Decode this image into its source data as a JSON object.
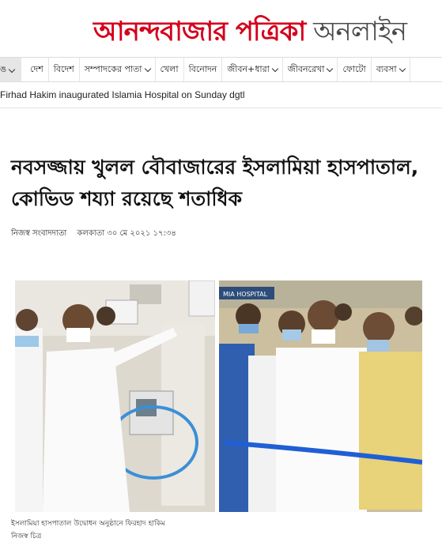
{
  "masthead": {
    "logo_red": "আনন্দবাজার পত্রিকা",
    "logo_grey": " অনলাইন"
  },
  "nav": {
    "first": "ঙ",
    "items": [
      {
        "label": "দেশ",
        "dropdown": false
      },
      {
        "label": "বিদেশ",
        "dropdown": false
      },
      {
        "label": "সম্পাদকের পাতা",
        "dropdown": true
      },
      {
        "label": "খেলা",
        "dropdown": false
      },
      {
        "label": "বিনোদন",
        "dropdown": false
      },
      {
        "label": "জীবন+ধারা",
        "dropdown": true
      },
      {
        "label": "জীবনরেখা",
        "dropdown": true
      },
      {
        "label": "ফোটো",
        "dropdown": false
      },
      {
        "label": "ব্যবসা",
        "dropdown": true
      }
    ]
  },
  "article": {
    "strap": "Firhad Hakim inaugurated Islamia Hospital on Sunday dgtl",
    "headline": "নবসজ্জায় খুলল বৌবাজারের ইসলামিয়া হাসপাতাল, কোভিড শয্যা রয়েছে শতাধিক",
    "author": "নিজস্ব সংবাদদাতা",
    "dateline": "কলকাতা ৩০ মে ২০২১ ১৭:৩৪",
    "photo_sign": "MIA HOSPITAL",
    "caption": "ইসলামিয়া হাসপাতাল উদ্বোধন অনুষ্ঠানে ফিরহাদ হাকিম",
    "credit": "নিজস্ব চিত্র"
  },
  "colors": {
    "brand_red": "#d4001c",
    "logo_grey": "#4a4a4a",
    "ribbon_blue": "#1f5fd6"
  }
}
